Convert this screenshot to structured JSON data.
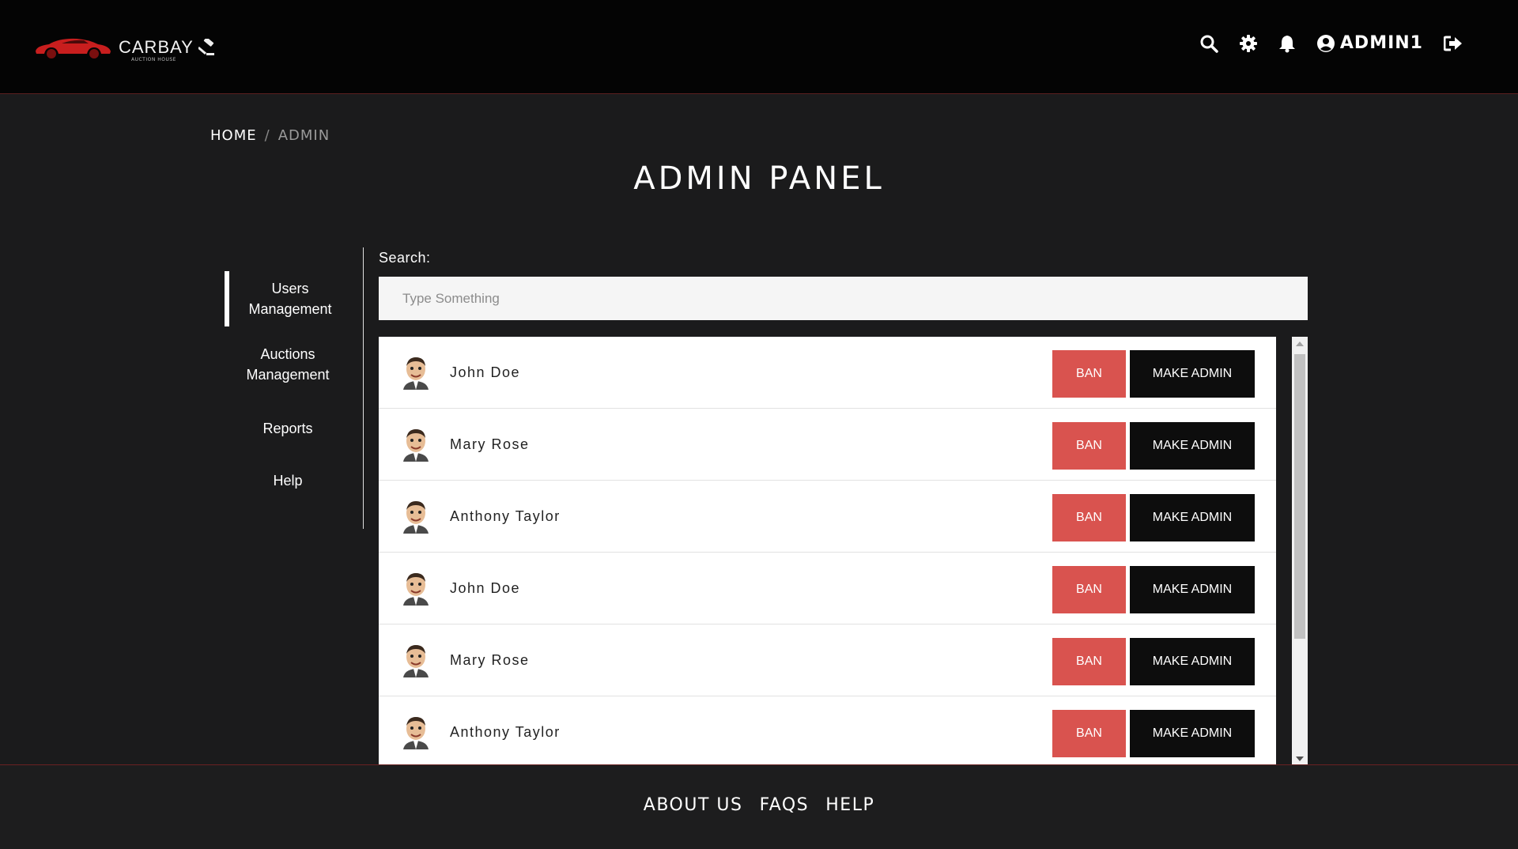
{
  "brand": {
    "name": "CARBAY",
    "tagline": "AUCTION HOUSE",
    "accent": "#c81e1e"
  },
  "header": {
    "icons": [
      "search-icon",
      "gear-icon",
      "bell-icon",
      "user-circle-icon",
      "sign-out-icon"
    ],
    "username": "ADMIN1"
  },
  "breadcrumb": {
    "home": "HOME",
    "separator": "/",
    "current": "ADMIN"
  },
  "page_title": "ADMIN PANEL",
  "sidebar": {
    "items": [
      {
        "label": "Users Management",
        "active": true
      },
      {
        "label": "Auctions Management",
        "active": false
      },
      {
        "label": "Reports",
        "active": false
      },
      {
        "label": "Help",
        "active": false
      }
    ]
  },
  "search": {
    "label": "Search:",
    "placeholder": "Type Something",
    "value": ""
  },
  "users": [
    {
      "name": "John Doe",
      "ban_label": "BAN",
      "admin_label": "MAKE ADMIN"
    },
    {
      "name": "Mary Rose",
      "ban_label": "BAN",
      "admin_label": "MAKE ADMIN"
    },
    {
      "name": "Anthony Taylor",
      "ban_label": "BAN",
      "admin_label": "MAKE ADMIN"
    },
    {
      "name": "John Doe",
      "ban_label": "BAN",
      "admin_label": "MAKE ADMIN"
    },
    {
      "name": "Mary Rose",
      "ban_label": "BAN",
      "admin_label": "MAKE ADMIN"
    },
    {
      "name": "Anthony Taylor",
      "ban_label": "BAN",
      "admin_label": "MAKE ADMIN"
    }
  ],
  "colors": {
    "ban_button": "#d9534f",
    "admin_button": "#0d0d0d",
    "page_background": "#1b1b1c"
  },
  "footer": {
    "links": [
      "ABOUT US",
      "FAQS",
      "HELP"
    ]
  }
}
